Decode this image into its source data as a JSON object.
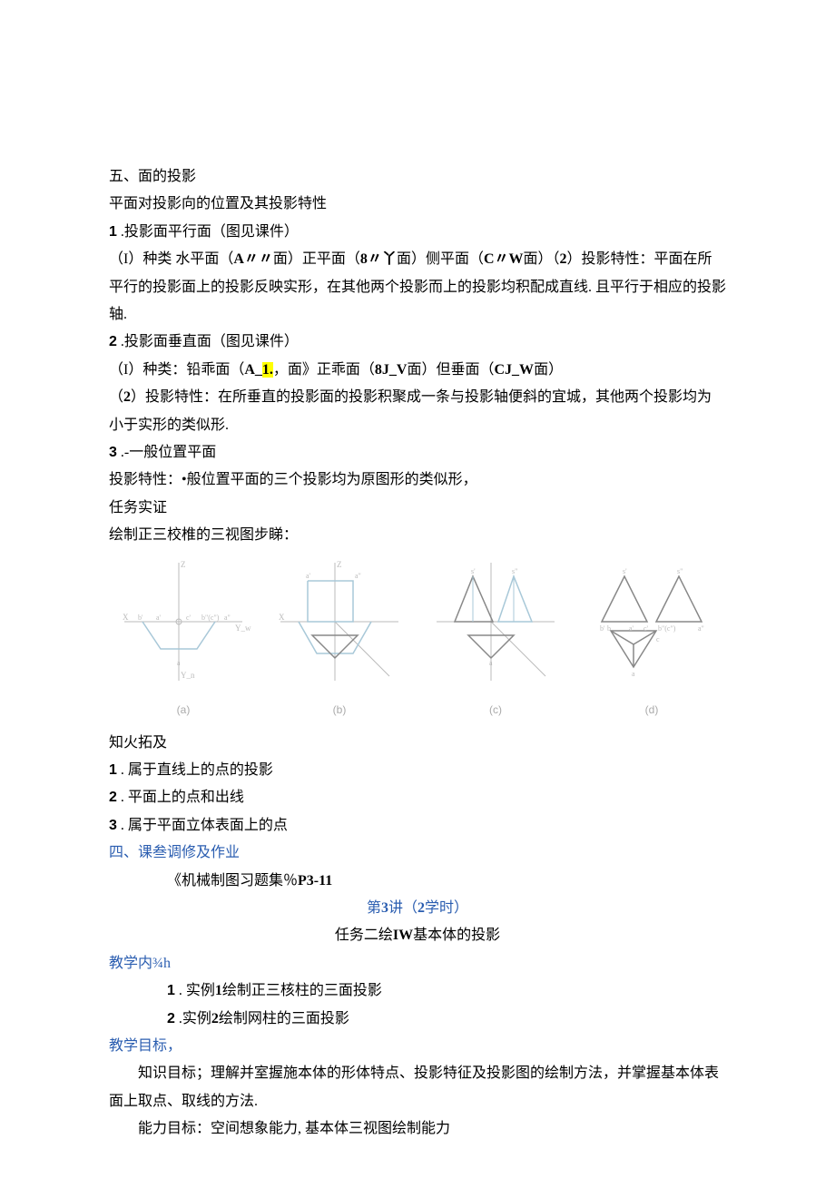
{
  "section5": {
    "heading": "五、面的投影",
    "intro": "平面对投影向的位置及其投影特性",
    "item1_num": "1",
    "item1_title": " .投影面平行面（图见课件）",
    "item1_p1_a": "（I）种类 水平面（",
    "item1_p1_b": "A〃〃",
    "item1_p1_c": "面）正平面（",
    "item1_p1_d": "8〃丫",
    "item1_p1_e": "面）侧平面（",
    "item1_p1_f": "C〃W",
    "item1_p1_g": "面）（",
    "item1_p1_h": "2",
    "item1_p1_i": "）投影特性：平面在所平行的投影面上的投影反映实形，在其他两个投影而上的投影均积配成直线. 且平行于相应的投影轴.",
    "item2_num": "2",
    "item2_title": " .投影面垂直面（图见课件）",
    "item2_p1_a": "（I）种类：铅乖面（",
    "item2_p1_b": "A_",
    "item2_p1_hl": "1.",
    "item2_p1_c": "，面》正乖面（",
    "item2_p1_d": "8J_V",
    "item2_p1_e": "面）但垂面（",
    "item2_p1_f": "CJ_W",
    "item2_p1_g": "面）",
    "item2_p2_a": "（",
    "item2_p2_b": "2",
    "item2_p2_c": "）投影特性：在所垂直的投影面的投影积聚成一条与投影轴便斜的宜城，其他两个投影均为小于实形的类似形.",
    "item3_num": "3",
    "item3_title": " .-一般位置平面",
    "item3_p1": "投影特性：•般位置平面的三个投影均为原图形的类似形，",
    "task_verify": "任务实证",
    "task_verify_desc": "绘制正三校椎的三视图步睇："
  },
  "diagram": {
    "labels": {
      "a": "(a)",
      "b": "(b)",
      "c": "(c)",
      "d": "(d)"
    }
  },
  "expand": {
    "heading": "知火拓及",
    "item1_num": "1",
    "item1_text": " . 属于直线上的点的投影",
    "item2_num": "2",
    "item2_text": " . 平面上的点和出线",
    "item3_num": "3",
    "item3_text": " . 属于平面立体表面上的点"
  },
  "section4": {
    "heading": "四、课叁调修及作业",
    "content_a": "《机械制图习题集％",
    "content_b": "P3-11"
  },
  "lecture": {
    "title_a": "第",
    "title_b": "3",
    "title_c": "讲（",
    "title_d": "2",
    "title_e": "学时）",
    "subtitle_a": "任务二绘",
    "subtitle_b": "IW",
    "subtitle_c": "基本体的投影"
  },
  "teach_content": {
    "heading": "教学内¾h",
    "item1_num": "1",
    "item1_a": " . 实例",
    "item1_b": "1",
    "item1_c": "绘制正三核柱的三面投影",
    "item2_num": "2",
    "item2_a": " .实例",
    "item2_b": "2",
    "item2_c": "绘制网柱的三面投影"
  },
  "teach_goal": {
    "heading": "教学目标，",
    "p1": "知识目标；理解并室握施本体的形体特点、投影特征及投影图的绘制方法，并掌握基本体表面上取点、取线的方法.",
    "p2": "能力目标：空间想象能力, 基本体三视图绘制能力"
  }
}
